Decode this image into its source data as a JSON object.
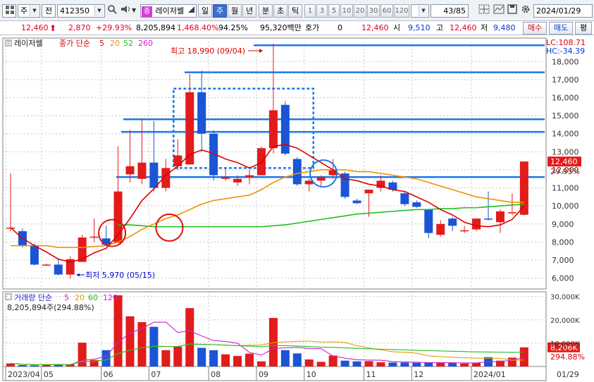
{
  "toolbar": {
    "market_code": "주",
    "type_code": "전",
    "stock_code": "412350",
    "indicator_badge": "종",
    "indicator_name": "레이저쎌",
    "periods": [
      "일",
      "주",
      "월",
      "년",
      "분",
      "초",
      "틱"
    ],
    "active_period": "주",
    "intervals": [
      "1",
      "3",
      "5",
      "10",
      "20",
      "30",
      "60",
      "120"
    ],
    "page_counter": "43/85",
    "date": "2024/01/29"
  },
  "quote": {
    "price": "12,460",
    "change": "2,870",
    "change_pct": "+29.93%",
    "volume": "8,205,894",
    "volume_ratio": "1,468.40%",
    "turnover_pct": "94.25%",
    "amount": "95,320백만",
    "hoga_label": "호가",
    "hoga_value": "0",
    "bid_price": "12,460",
    "open_label": "시",
    "open": "9,510",
    "high_label": "고",
    "high": "12,460",
    "low_label": "저",
    "low": "9,480",
    "buy_label": "매수",
    "sell_label": "매도",
    "flat_label": "평"
  },
  "price_legend": {
    "name": "레이저쎌",
    "ma_label": "종가 단순",
    "ma_periods": [
      "5",
      "20",
      "52",
      "260"
    ],
    "ma_colors": [
      "#e00000",
      "#f09000",
      "#20c020",
      "#d020d0"
    ]
  },
  "volume_legend": {
    "label": "거래량 단순",
    "ma_periods": [
      "5",
      "20",
      "60",
      "120"
    ],
    "value": "8,205,894주(294.88%)"
  },
  "chart_data": {
    "type": "candlestick",
    "y_ticks": [
      6000,
      7000,
      8000,
      9000,
      10000,
      11000,
      12000,
      13000,
      14000,
      15000,
      16000,
      17000,
      18000
    ],
    "y_tick_labels": [
      "6,000",
      "7,000",
      "8,000",
      "9,000",
      "10,000",
      "11,000",
      "12,000",
      "13,000",
      "14,000",
      "15,000",
      "16,000",
      "17,000",
      "18,000"
    ],
    "ylim": [
      5400,
      19300
    ],
    "x_labels": [
      "2023/04",
      "05",
      "06",
      "07",
      "08",
      "09",
      "10",
      "11",
      "12",
      "2024/01"
    ],
    "x_label_weeks": [
      0,
      3,
      8,
      12,
      17,
      21,
      25,
      30,
      34,
      39
    ],
    "last_date_label": "01/29",
    "weeks": [
      {
        "o": 8750,
        "h": 11800,
        "l": 8600,
        "c": 8800
      },
      {
        "o": 8600,
        "h": 8750,
        "l": 7700,
        "c": 7800
      },
      {
        "o": 7800,
        "h": 7900,
        "l": 6700,
        "c": 6750
      },
      {
        "o": 6750,
        "h": 6800,
        "l": 6700,
        "c": 6750
      },
      {
        "o": 6750,
        "h": 7100,
        "l": 6150,
        "c": 6200
      },
      {
        "o": 6200,
        "h": 7200,
        "l": 5970,
        "c": 7050
      },
      {
        "o": 6900,
        "h": 8400,
        "l": 6900,
        "c": 8250
      },
      {
        "o": 8250,
        "h": 9300,
        "l": 8000,
        "c": 8300
      },
      {
        "o": 8200,
        "h": 8900,
        "l": 7800,
        "c": 7850
      },
      {
        "o": 7950,
        "h": 13300,
        "l": 7950,
        "c": 10800
      },
      {
        "o": 11750,
        "h": 14200,
        "l": 11300,
        "c": 12200
      },
      {
        "o": 11500,
        "h": 14800,
        "l": 11200,
        "c": 12400
      },
      {
        "o": 12400,
        "h": 14700,
        "l": 10800,
        "c": 11000
      },
      {
        "o": 11000,
        "h": 12600,
        "l": 10800,
        "c": 12100
      },
      {
        "o": 12200,
        "h": 13700,
        "l": 12000,
        "c": 12800
      },
      {
        "o": 12300,
        "h": 17300,
        "l": 12300,
        "c": 16300
      },
      {
        "o": 16300,
        "h": 17500,
        "l": 13000,
        "c": 14000
      },
      {
        "o": 14000,
        "h": 14200,
        "l": 11400,
        "c": 11700
      },
      {
        "o": 11500,
        "h": 12100,
        "l": 11400,
        "c": 11600
      },
      {
        "o": 11300,
        "h": 11700,
        "l": 11100,
        "c": 11500
      },
      {
        "o": 11600,
        "h": 12000,
        "l": 11200,
        "c": 11700
      },
      {
        "o": 11700,
        "h": 13300,
        "l": 11700,
        "c": 13200
      },
      {
        "o": 13200,
        "h": 18990,
        "l": 12900,
        "c": 15300
      },
      {
        "o": 15600,
        "h": 15800,
        "l": 12800,
        "c": 12900
      },
      {
        "o": 12600,
        "h": 12700,
        "l": 11100,
        "c": 11200
      },
      {
        "o": 11200,
        "h": 11500,
        "l": 10800,
        "c": 11400
      },
      {
        "o": 11400,
        "h": 11700,
        "l": 11100,
        "c": 11600
      },
      {
        "o": 11700,
        "h": 12600,
        "l": 11500,
        "c": 12000
      },
      {
        "o": 11800,
        "h": 11900,
        "l": 10400,
        "c": 10500
      },
      {
        "o": 10300,
        "h": 10400,
        "l": 10100,
        "c": 10150
      },
      {
        "o": 10700,
        "h": 10900,
        "l": 9400,
        "c": 10900
      },
      {
        "o": 11000,
        "h": 11700,
        "l": 10800,
        "c": 11400
      },
      {
        "o": 11300,
        "h": 11400,
        "l": 10800,
        "c": 10900
      },
      {
        "o": 10700,
        "h": 10800,
        "l": 10000,
        "c": 10100
      },
      {
        "o": 10200,
        "h": 10300,
        "l": 9900,
        "c": 9950
      },
      {
        "o": 9800,
        "h": 9850,
        "l": 8200,
        "c": 8500
      },
      {
        "o": 8400,
        "h": 9200,
        "l": 8300,
        "c": 9000
      },
      {
        "o": 9300,
        "h": 9400,
        "l": 8600,
        "c": 8900
      },
      {
        "o": 8600,
        "h": 8900,
        "l": 8500,
        "c": 8650
      },
      {
        "o": 8700,
        "h": 9300,
        "l": 8600,
        "c": 9300
      },
      {
        "o": 9300,
        "h": 10800,
        "l": 9200,
        "c": 9250
      },
      {
        "o": 9100,
        "h": 9800,
        "l": 8500,
        "c": 9700
      },
      {
        "o": 9600,
        "h": 10700,
        "l": 9500,
        "c": 9650
      },
      {
        "o": 9510,
        "h": 12460,
        "l": 9480,
        "c": 12460
      }
    ],
    "ma5": [
      8800,
      8200,
      7800,
      7450,
      7050,
      6900,
      7050,
      7400,
      7650,
      8400,
      9300,
      10300,
      10950,
      11700,
      12200,
      12850,
      13100,
      12900,
      12600,
      12400,
      12100,
      12400,
      13300,
      13400,
      13200,
      12800,
      12400,
      12000,
      11500,
      11400,
      11200,
      11100,
      10900,
      10800,
      10500,
      10200,
      9800,
      9500,
      9100,
      8900,
      8850,
      8950,
      9250,
      10000
    ],
    "ma20": [
      7800,
      7800,
      7800,
      7800,
      7700,
      7700,
      7700,
      7750,
      7800,
      8000,
      8300,
      8700,
      9000,
      9300,
      9500,
      9800,
      10100,
      10300,
      10400,
      10500,
      10600,
      10900,
      11300,
      11600,
      11800,
      11900,
      12000,
      12000,
      12000,
      11900,
      11900,
      11800,
      11700,
      11600,
      11500,
      11300,
      11100,
      10900,
      10700,
      10500,
      10400,
      10300,
      10200,
      10200
    ],
    "ma52": [
      null,
      null,
      null,
      null,
      null,
      null,
      null,
      null,
      null,
      8950,
      8950,
      8900,
      8850,
      8850,
      8850,
      8850,
      8850,
      8850,
      8850,
      8850,
      8850,
      8850,
      8900,
      8950,
      9050,
      9150,
      9250,
      9350,
      9450,
      9550,
      9600,
      9650,
      9700,
      9750,
      9800,
      9800,
      9850,
      9850,
      9900,
      9900,
      9950,
      10000,
      10050,
      10100
    ],
    "volume": [
      1300,
      600,
      500,
      700,
      1000,
      900,
      10200,
      2800,
      7000,
      30500,
      21500,
      19000,
      17000,
      7000,
      8500,
      25000,
      8000,
      7000,
      5200,
      4500,
      5500,
      2200,
      20800,
      7000,
      5600,
      3000,
      2000,
      4700,
      2500,
      2200,
      2300,
      1800,
      1700,
      1700,
      1600,
      1700,
      1500,
      1600,
      1300,
      1500,
      4000,
      2500,
      3800,
      8206
    ],
    "vol_ma_lines": {
      "ma5_color": "#d020d0",
      "ma20_color": "#e0a000",
      "ma60_color": "#20c020"
    },
    "vol_y_ticks": [
      10000,
      20000,
      30000
    ],
    "vol_y_labels": [
      "10,000K",
      "20,000K",
      "30,000K"
    ],
    "vol_ylim": [
      0,
      32000
    ],
    "annotations": {
      "max_label": "최고 18,990 (09/04)",
      "min_label": "최저 5,970 (05/15)",
      "lc_label": "LC:108.71",
      "hc_label": "HC:-34.39",
      "price_badge": "12,460",
      "price_pct": "29.93%",
      "vol_badge": "8,206K",
      "vol_pct": "294.88%"
    },
    "horizontal_levels": [
      18900,
      17400,
      14800,
      14100,
      11600
    ],
    "dotted_box": {
      "week_start": 14,
      "week_end": 25,
      "y_top": 16500,
      "y_bottom": 12100
    },
    "circle_marks": [
      {
        "week": 8.5,
        "y": 8500
      },
      {
        "week": 13.3,
        "y": 8800
      },
      {
        "week": 26.2,
        "y": 11800
      }
    ]
  },
  "colors": {
    "up": "#e21b1b",
    "down": "#1a55d6",
    "level_line": "#1e78e8",
    "axis_text": "#333333"
  }
}
